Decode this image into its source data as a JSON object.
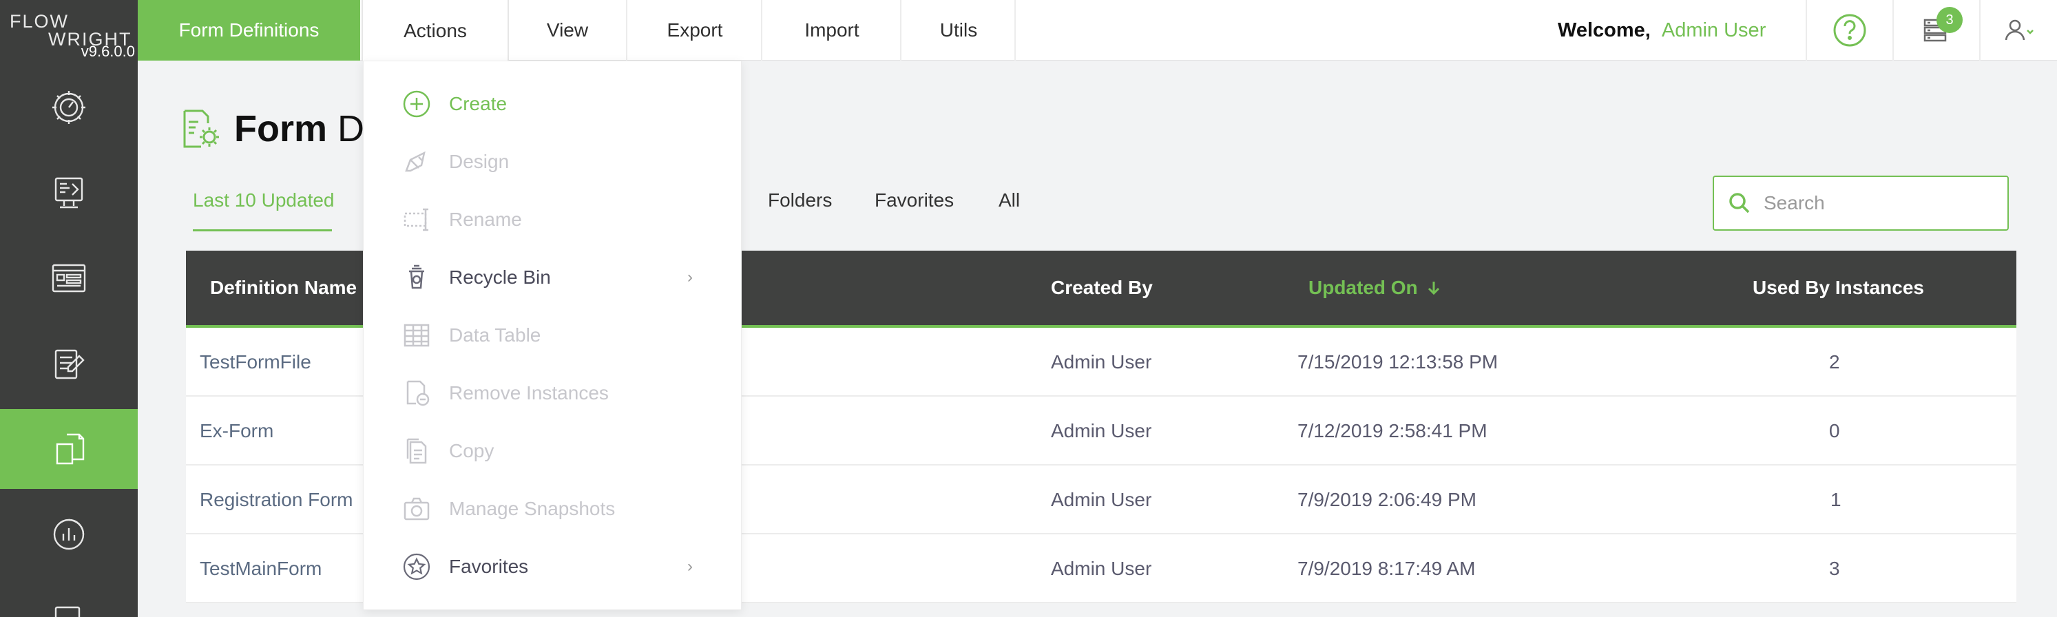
{
  "app": {
    "logo_line1": "FLOW",
    "logo_line2": "WRIGHT",
    "version": "v9.6.0.0",
    "brand_color": "#74c054",
    "sidebar_color": "#3d3e3d"
  },
  "sidebar": {
    "items": [
      {
        "icon": "dashboard-gear-icon",
        "active": false
      },
      {
        "icon": "process-design-icon",
        "active": false
      },
      {
        "icon": "web-form-icon",
        "active": false
      },
      {
        "icon": "edit-document-icon",
        "active": false
      },
      {
        "icon": "form-definitions-icon",
        "active": true
      },
      {
        "icon": "reports-chart-icon",
        "active": false
      },
      {
        "icon": "schedule-icon",
        "active": false
      }
    ]
  },
  "topbar": {
    "tabs": [
      "Form Definitions",
      "Actions",
      "View",
      "Export",
      "Import",
      "Utils"
    ],
    "welcome_label": "Welcome,",
    "user_name": "Admin User",
    "notification_count": "3"
  },
  "page": {
    "title_bold": "Form",
    "title_rest": " Definitions"
  },
  "subtabs": [
    "Last 10 Updated",
    "Folders",
    "Favorites",
    "All"
  ],
  "search": {
    "placeholder": "Search"
  },
  "table": {
    "columns": [
      "Definition Name",
      "Created By",
      "Updated On",
      "Used By Instances"
    ],
    "sorted_column": "Updated On",
    "rows": [
      {
        "name": "TestFormFile",
        "created_by": "Admin User",
        "updated_on": "7/15/2019 12:13:58 PM",
        "instances": "2"
      },
      {
        "name": "Ex-Form",
        "created_by": "Admin User",
        "updated_on": "7/12/2019 2:58:41 PM",
        "instances": "0"
      },
      {
        "name": "Registration Form",
        "created_by": "Admin User",
        "updated_on": "7/9/2019 2:06:49 PM",
        "instances": "1"
      },
      {
        "name": "TestMainForm",
        "created_by": "Admin User",
        "updated_on": "7/9/2019 8:17:49 AM",
        "instances": "3"
      }
    ]
  },
  "actions_menu": {
    "items": [
      {
        "label": "Create",
        "state": "green",
        "icon": "plus-circle-icon",
        "submenu": false
      },
      {
        "label": "Design",
        "state": "disabled",
        "icon": "design-pencil-icon",
        "submenu": false
      },
      {
        "label": "Rename",
        "state": "disabled",
        "icon": "rename-cursor-icon",
        "submenu": false
      },
      {
        "label": "Recycle Bin",
        "state": "enabled",
        "icon": "recycle-bin-icon",
        "submenu": true
      },
      {
        "label": "Data Table",
        "state": "disabled",
        "icon": "data-table-icon",
        "submenu": false
      },
      {
        "label": "Remove Instances",
        "state": "disabled",
        "icon": "remove-instances-icon",
        "submenu": false
      },
      {
        "label": "Copy",
        "state": "disabled",
        "icon": "copy-icon",
        "submenu": false
      },
      {
        "label": "Manage Snapshots",
        "state": "disabled",
        "icon": "camera-icon",
        "submenu": false
      },
      {
        "label": "Favorites",
        "state": "enabled",
        "icon": "star-circle-icon",
        "submenu": true
      }
    ]
  }
}
